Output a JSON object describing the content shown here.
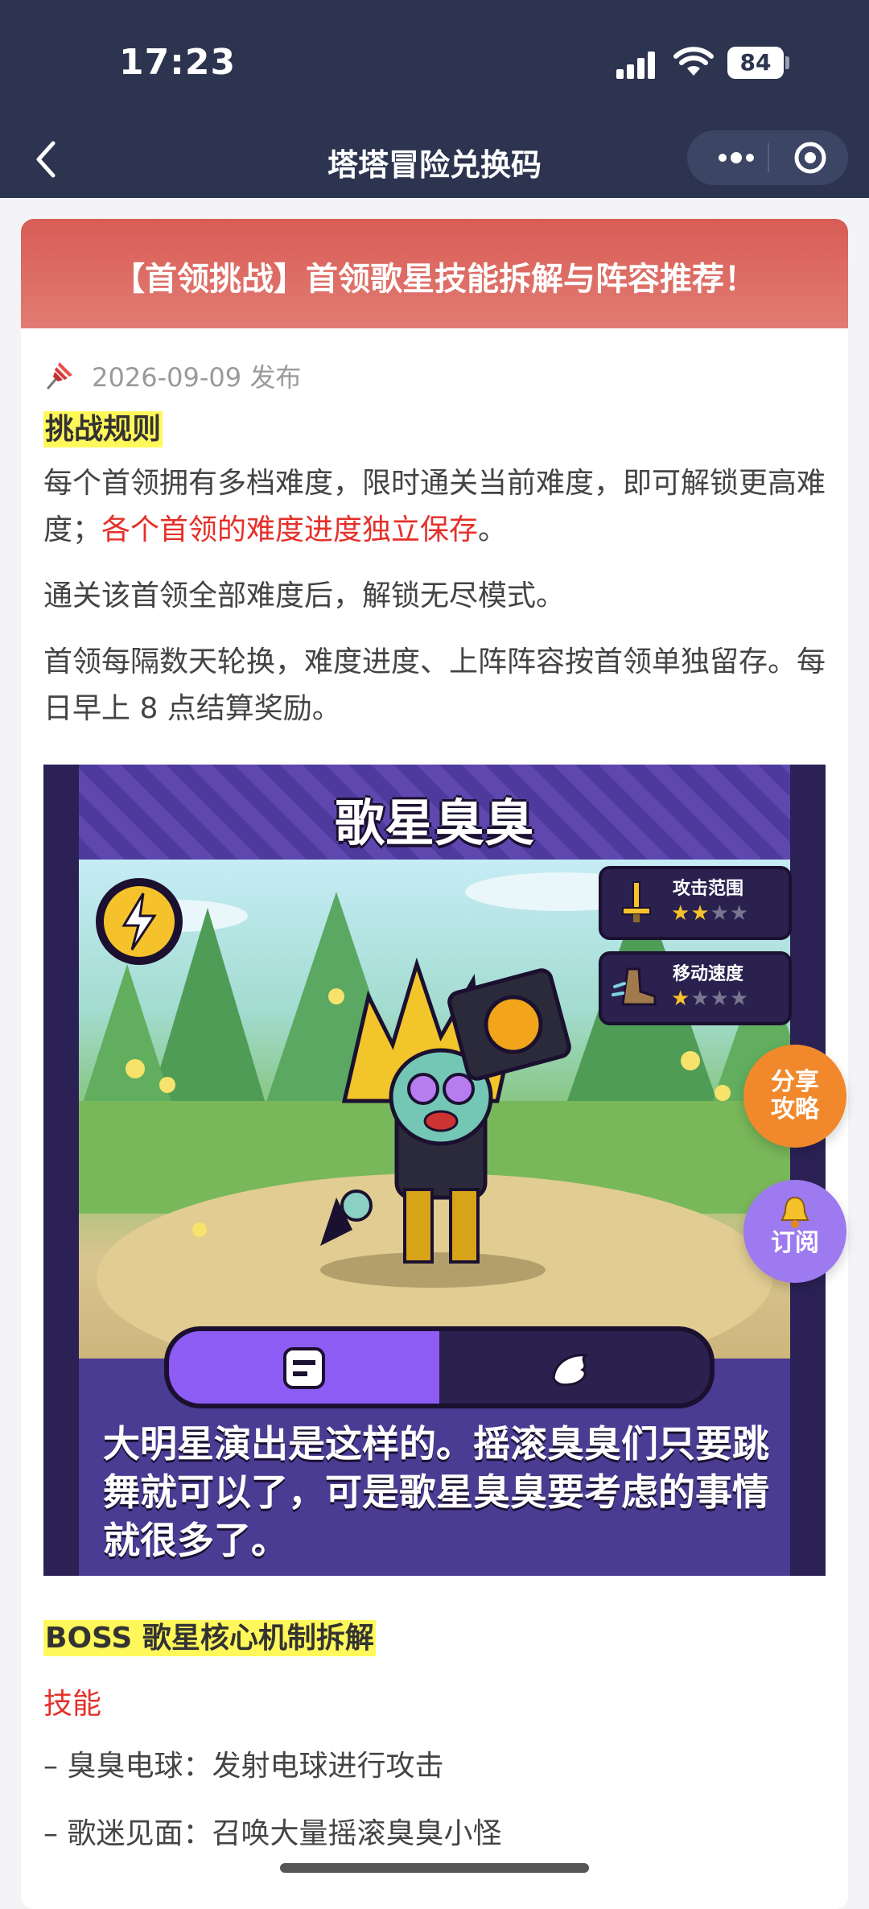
{
  "status_bar": {
    "time": "17:23",
    "battery": "84",
    "icons": [
      "signal-icon",
      "wifi-icon",
      "battery-icon"
    ]
  },
  "nav": {
    "title": "塔塔冒险兑换码",
    "back_icon": "chevron-left-icon",
    "more_icon": "more-dots-icon",
    "close_icon": "target-circle-icon"
  },
  "article": {
    "banner_title": "【首领挑战】首领歌星技能拆解与阵容推荐！",
    "publish_date": "2026-09-09",
    "publish_suffix": "发布",
    "rules_heading": "挑战规则",
    "para1_a": "每个首领拥有多档难度，限时通关当前难度，即可解锁更高难度；",
    "para1_red": "各个首领的难度进度独立保存",
    "para1_end": "。",
    "para2": "通关该首领全部难度后，解锁无尽模式。",
    "para3": "首领每隔数天轮换，难度进度、上阵阵容按首领单独留存。每日早上 8 点结算奖励。",
    "boss_section_heading": "BOSS 歌星核心机制拆解",
    "skills_heading": "技能",
    "skill1": "– 臭臭电球：发射电球进行攻击",
    "skill2": "– 歌迷见面：召唤大量摇滚臭臭小怪"
  },
  "hero_card": {
    "boss_name": "歌星臭臭",
    "stat1_label": "攻击范围",
    "stat1_stars": 2,
    "stat2_label": "移动速度",
    "stat2_stars": 1,
    "stars_total": 4,
    "description": "大明星演出是这样的。摇滚臭臭们只要跳舞就可以了，可是歌星臭臭要考虑的事情就很多了。"
  },
  "fabs": {
    "share_line1": "分享",
    "share_line2": "攻略",
    "subscribe_label": "订阅"
  },
  "colors": {
    "status_bg": "#2c3450",
    "banner": "#d85c56",
    "highlight": "#fff85a",
    "red_text": "#e5302a",
    "share_fab": "#f1892c",
    "subscribe_fab": "#9d7af0"
  }
}
